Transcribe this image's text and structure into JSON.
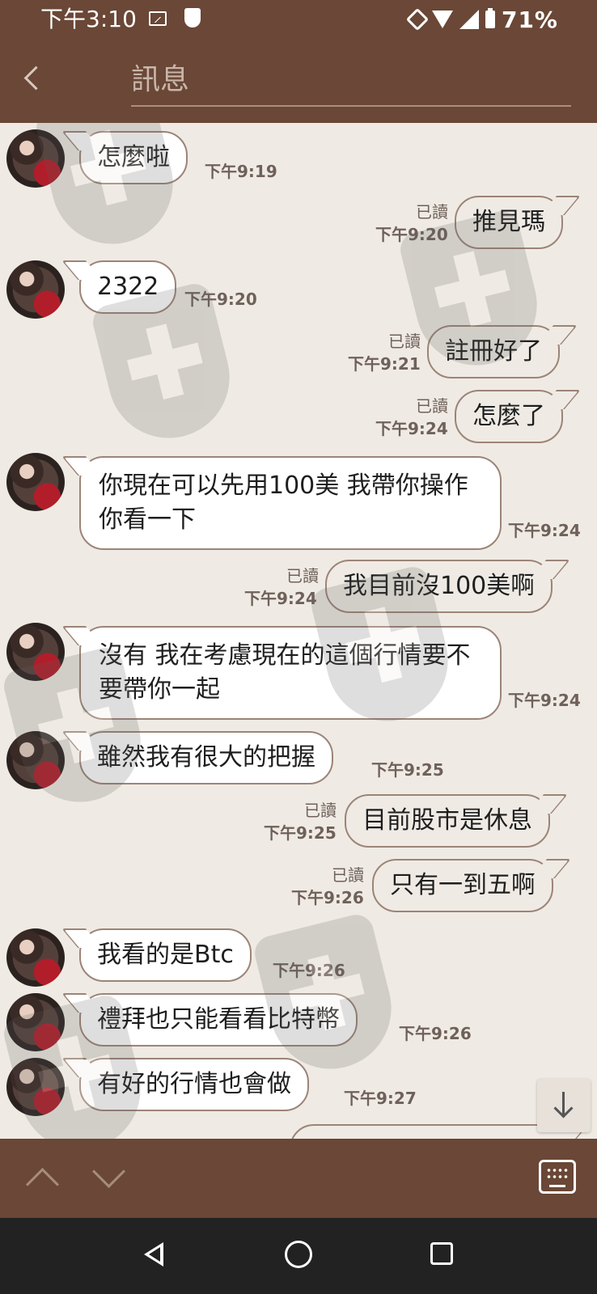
{
  "status_bar": {
    "time": "下午3:10",
    "battery": "71%"
  },
  "header": {
    "title": "訊息"
  },
  "messages": [
    {
      "direction": "in",
      "text": "怎麼啦",
      "time": "下午9:19"
    },
    {
      "direction": "out",
      "text": "推見瑪",
      "time": "下午9:20",
      "read": "已讀"
    },
    {
      "direction": "in",
      "text": "2322",
      "time": "下午9:20"
    },
    {
      "direction": "out",
      "text": "註冊好了",
      "time": "下午9:21",
      "read": "已讀"
    },
    {
      "direction": "out",
      "text": "怎麼了",
      "time": "下午9:24",
      "read": "已讀"
    },
    {
      "direction": "in",
      "text": "你現在可以先用100美 我帶你操作你看一下",
      "time": "下午9:24"
    },
    {
      "direction": "out",
      "text": "我目前沒100美啊",
      "time": "下午9:24",
      "read": "已讀"
    },
    {
      "direction": "in",
      "text": "沒有 我在考慮現在的這個行情要不要帶你一起",
      "time": "下午9:24"
    },
    {
      "direction": "in",
      "text": "雖然我有很大的把握",
      "time": "下午9:25"
    },
    {
      "direction": "out",
      "text": "目前股市是休息",
      "time": "下午9:25",
      "read": "已讀"
    },
    {
      "direction": "out",
      "text": "只有一到五啊",
      "time": "下午9:26",
      "read": "已讀"
    },
    {
      "direction": "in",
      "text": "我看的是Btc",
      "time": "下午9:26"
    },
    {
      "direction": "in",
      "text": "禮拜也只能看看比特幣",
      "time": "下午9:26"
    },
    {
      "direction": "in",
      "text": "有好的行情也會做",
      "time": "下午9:27"
    }
  ]
}
